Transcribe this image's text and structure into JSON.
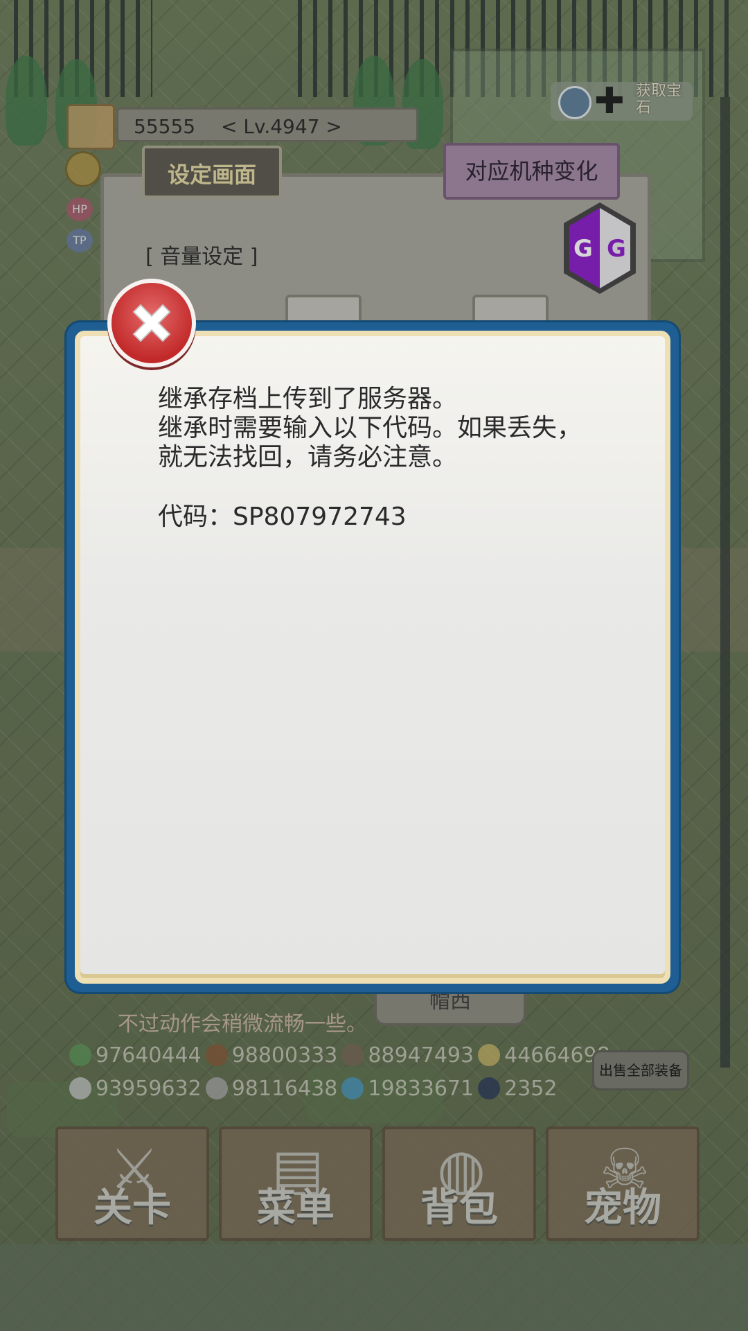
{
  "player": {
    "name": "55555",
    "level": "< Lv.4947 >",
    "hp_label": "HP",
    "tp_label": "TP"
  },
  "gem_shop": {
    "label": "获取宝石"
  },
  "settings": {
    "tab_title": "设定画面",
    "device_button": "对应机种变化",
    "volume_section": "[ 音量设定 ]",
    "gg_label": "GG"
  },
  "background_text": {
    "line2": "不过动作会稍微流畅一些。",
    "chip": "帽西"
  },
  "resources": {
    "row1": [
      "97640444",
      "98800333",
      "88947493",
      "44664698"
    ],
    "row2": [
      "93959632",
      "98116438",
      "19833671",
      "2352"
    ]
  },
  "sell_all_button": "出售全部装备",
  "nav": [
    {
      "label": "关卡",
      "icon": "crossed-swords-icon"
    },
    {
      "label": "菜单",
      "icon": "book-icon"
    },
    {
      "label": "背包",
      "icon": "backpack-icon"
    },
    {
      "label": "宠物",
      "icon": "dragon-skull-icon"
    }
  ],
  "dialog": {
    "message": "继承存档上传到了服务器。\n继承时需要输入以下代码。如果丢失，\n就无法找回，请务必注意。",
    "code_label": "代码：SP807972743"
  },
  "colors": {
    "dialog_frame": "#1e5e93",
    "close_button": "#c22a2a",
    "device_button": "#a48aa7"
  }
}
